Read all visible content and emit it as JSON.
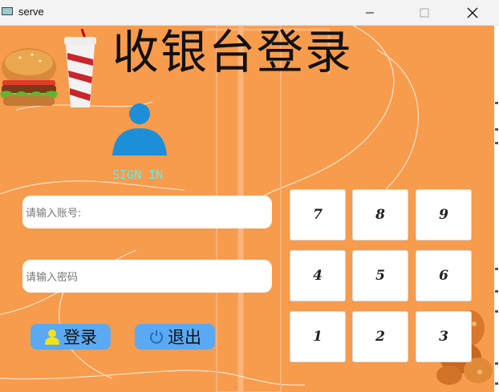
{
  "window": {
    "title": "serve"
  },
  "header": {
    "title": "收银台登录"
  },
  "login": {
    "signin_label": "SIGN IN",
    "account_placeholder": "请输入账号:",
    "password_placeholder": "请输入密码",
    "login_label": "登录",
    "exit_label": "退出"
  },
  "keypad": {
    "keys": [
      "7",
      "8",
      "9",
      "4",
      "5",
      "6",
      "1",
      "2",
      "3"
    ]
  },
  "colors": {
    "background": "#f79b4c",
    "button": "#5aa9f2",
    "signin": "#62ecea",
    "avatar": "#1d8fd9"
  },
  "icons": [
    "burger-icon",
    "drink-cup-icon",
    "user-avatar-icon",
    "user-icon",
    "power-icon",
    "fried-chicken-icon",
    "minimize-icon",
    "maximize-icon",
    "close-icon"
  ]
}
